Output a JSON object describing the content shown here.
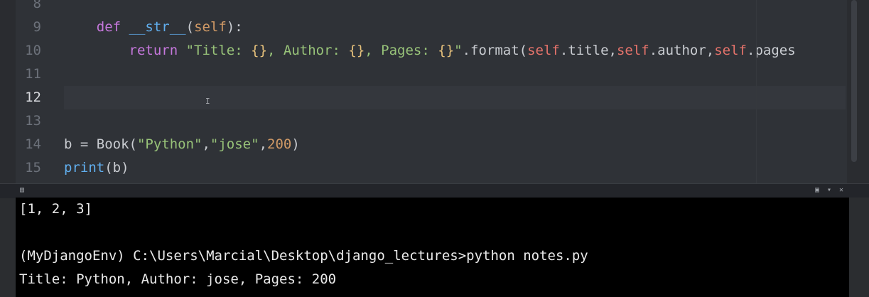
{
  "editor": {
    "lines": [
      {
        "number": "8",
        "tokens": []
      },
      {
        "number": "9",
        "tokens": [
          {
            "t": "    ",
            "c": "pln"
          },
          {
            "t": "def",
            "c": "kw"
          },
          {
            "t": " ",
            "c": "pln"
          },
          {
            "t": "__str__",
            "c": "fn"
          },
          {
            "t": "(",
            "c": "pln"
          },
          {
            "t": "self",
            "c": "num"
          },
          {
            "t": "):",
            "c": "pln"
          }
        ]
      },
      {
        "number": "10",
        "tokens": [
          {
            "t": "        ",
            "c": "pln"
          },
          {
            "t": "return",
            "c": "kw"
          },
          {
            "t": " ",
            "c": "pln"
          },
          {
            "t": "\"Title: ",
            "c": "str"
          },
          {
            "t": "{}",
            "c": "brc"
          },
          {
            "t": ", Author: ",
            "c": "str"
          },
          {
            "t": "{}",
            "c": "brc"
          },
          {
            "t": ", Pages: ",
            "c": "str"
          },
          {
            "t": "{}",
            "c": "brc"
          },
          {
            "t": "\"",
            "c": "str"
          },
          {
            "t": ".format(",
            "c": "pln"
          },
          {
            "t": "self",
            "c": "slf"
          },
          {
            "t": ".title,",
            "c": "pln"
          },
          {
            "t": "self",
            "c": "slf"
          },
          {
            "t": ".author,",
            "c": "pln"
          },
          {
            "t": "self",
            "c": "slf"
          },
          {
            "t": ".pages",
            "c": "pln"
          }
        ]
      },
      {
        "number": "11",
        "tokens": []
      },
      {
        "number": "12",
        "tokens": [],
        "active": true
      },
      {
        "number": "13",
        "tokens": []
      },
      {
        "number": "14",
        "tokens": [
          {
            "t": "b = Book(",
            "c": "pln"
          },
          {
            "t": "\"Python\"",
            "c": "str"
          },
          {
            "t": ",",
            "c": "pln"
          },
          {
            "t": "\"jose\"",
            "c": "str"
          },
          {
            "t": ",",
            "c": "pln"
          },
          {
            "t": "200",
            "c": "num"
          },
          {
            "t": ")",
            "c": "pln"
          }
        ]
      },
      {
        "number": "15",
        "tokens": [
          {
            "t": "print",
            "c": "fn"
          },
          {
            "t": "(b)",
            "c": "pln"
          }
        ]
      }
    ]
  },
  "panel_bar": {
    "icons": [
      "panel-toggle-icon",
      "maximize-icon",
      "minimize-icon",
      "close-icon"
    ]
  },
  "console": {
    "lines": [
      "[1, 2, 3]",
      "",
      "(MyDjangoEnv) C:\\Users\\Marcial\\Desktop\\django_lectures>python notes.py",
      "Title: Python, Author: jose, Pages: 200"
    ]
  }
}
